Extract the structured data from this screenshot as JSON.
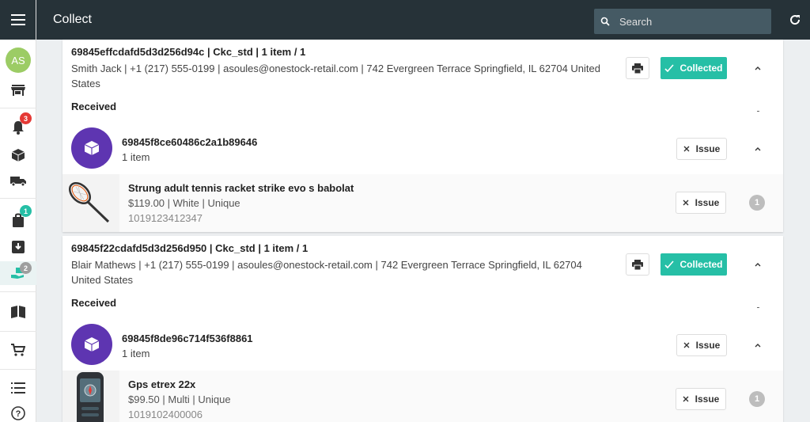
{
  "header": {
    "title": "Collect",
    "search_placeholder": "Search"
  },
  "user": {
    "initials": "AS"
  },
  "sidebar": {
    "items": [
      {
        "name": "store",
        "badge": ""
      },
      {
        "name": "bell",
        "badge": "3",
        "badge_color": "#e53935"
      },
      {
        "name": "package",
        "badge": ""
      },
      {
        "name": "truck",
        "badge": ""
      },
      {
        "name": "bag",
        "badge": "1",
        "badge_color": "#26bfa6"
      },
      {
        "name": "inbox-download",
        "badge": ""
      },
      {
        "name": "hand-parcel",
        "badge": "2",
        "badge_color": "#9e9e9e"
      },
      {
        "name": "book",
        "badge": ""
      },
      {
        "name": "cart",
        "badge": ""
      },
      {
        "name": "list",
        "badge": ""
      },
      {
        "name": "help",
        "badge": ""
      }
    ]
  },
  "orders": [
    {
      "id_line": "69845effcdafd5d3d256d94c | Ckc_std | 1 item / 1",
      "info_line": "Smith Jack | +1 (217) 555-0199 | asoules@onestock-retail.com | 742 Evergreen Terrace Springfield, IL 62704 United States",
      "status_label": "Collected",
      "section_label": "Received",
      "parcel": {
        "id": "69845f8ce60486c2a1b89646",
        "count": "1 item",
        "issue_label": "Issue"
      },
      "item": {
        "name": "Strung adult tennis racket strike evo s babolat",
        "meta": "$119.00 | White | Unique",
        "sku": "1019123412347",
        "qty": "1",
        "issue_label": "Issue"
      }
    },
    {
      "id_line": "69845f22cdafd5d3d256d950 | Ckc_std | 1 item / 1",
      "info_line": "Blair Mathews | +1 (217) 555-0199 | asoules@onestock-retail.com | 742 Evergreen Terrace Springfield, IL 62704 United States",
      "status_label": "Collected",
      "section_label": "Received",
      "parcel": {
        "id": "69845f8de96c714f536f8861",
        "count": "1 item",
        "issue_label": "Issue"
      },
      "item": {
        "name": "Gps etrex 22x",
        "meta": "$99.50 | Multi | Unique",
        "sku": "1019102400006",
        "qty": "1",
        "issue_label": "Issue"
      }
    }
  ],
  "colors": {
    "topbar": "#263238",
    "accent": "#26bfa6",
    "parcel": "#5e35b1"
  }
}
